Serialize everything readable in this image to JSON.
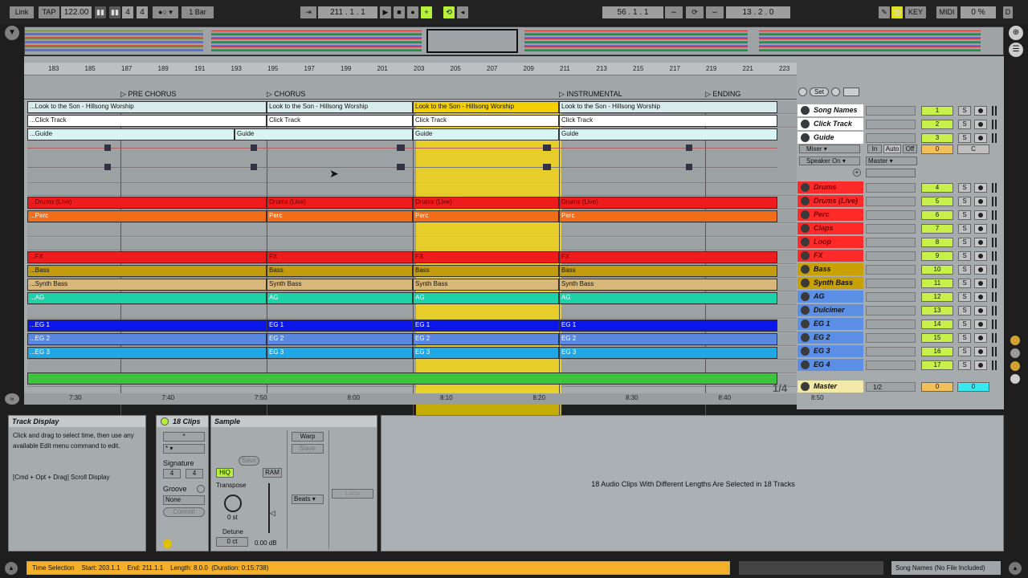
{
  "transport": {
    "link": "Link",
    "tap": "TAP",
    "tempo": "122.00",
    "sig_num": "4",
    "sig_den": "4",
    "quantize": "1 Bar",
    "position": "211 .   1 .   1",
    "loop_start": "56 .   1 .   1",
    "loop_length": "13 .   2 .   0",
    "key": "KEY",
    "midi": "MIDI",
    "cpu": "0 %",
    "disk": "D"
  },
  "ruler": {
    "bars": [
      "183",
      "185",
      "187",
      "189",
      "191",
      "193",
      "195",
      "197",
      "199",
      "201",
      "203",
      "205",
      "207",
      "209",
      "211",
      "213",
      "215",
      "217",
      "219",
      "221",
      "223"
    ]
  },
  "locators": [
    {
      "label": "PRE CHORUS"
    },
    {
      "label": "CHORUS"
    },
    {
      "label": "INSTRUMENTAL"
    },
    {
      "label": "ENDING"
    }
  ],
  "set_label": "Set",
  "times": [
    "7:30",
    "7:40",
    "7:50",
    "8:00",
    "8:10",
    "8:20",
    "8:30",
    "8:40",
    "8:50"
  ],
  "page_indicator": "1/4",
  "clips": {
    "song_names_a": "...Look to the Son - Hillsong Worship",
    "song_names": "Look to the Son - Hillsong Worship",
    "click_a": "...Click Track",
    "click": "Click Track",
    "guide_a": "...Guide",
    "guide": "Guide",
    "drums_a": "...Drums (Live)",
    "drums": "Drums (Live)",
    "perc_a": "...Perc",
    "perc": "Perc",
    "fx_a": "...FX",
    "fx": "FX",
    "bass_a": "...Bass",
    "bass": "Bass",
    "synth_a": "...Synth Bass",
    "synth": "Synth Bass",
    "ag_a": "...AG",
    "ag": "AG",
    "eg1_a": "...EG 1",
    "eg1": "EG 1",
    "eg2_a": "...EG 2",
    "eg2": "EG 2",
    "eg3_a": "...EG 3",
    "eg3": "EG 3",
    "s_trunc": "S"
  },
  "tracks": [
    {
      "name": "Song Names",
      "num": "1",
      "color": "#ffffff"
    },
    {
      "name": "Click Track",
      "num": "2",
      "color": "#ffffff"
    },
    {
      "name": "Guide",
      "num": "3",
      "color": "#ffffff"
    },
    {
      "name": "Drums",
      "num": "4",
      "color": "#ff2a2a"
    },
    {
      "name": "Drums (Live)",
      "num": "5",
      "color": "#ff2a2a"
    },
    {
      "name": "Perc",
      "num": "6",
      "color": "#ff2a2a"
    },
    {
      "name": "Claps",
      "num": "7",
      "color": "#ff2a2a"
    },
    {
      "name": "Loop",
      "num": "8",
      "color": "#ff2a2a"
    },
    {
      "name": "FX",
      "num": "9",
      "color": "#ff2a2a"
    },
    {
      "name": "Bass",
      "num": "10",
      "color": "#c8a000"
    },
    {
      "name": "Synth Bass",
      "num": "11",
      "color": "#c8a000"
    },
    {
      "name": "AG",
      "num": "12",
      "color": "#5b8fe6"
    },
    {
      "name": "Dulcimer",
      "num": "13",
      "color": "#5b8fe6"
    },
    {
      "name": "EG 1",
      "num": "14",
      "color": "#5b8fe6"
    },
    {
      "name": "EG 2",
      "num": "15",
      "color": "#5b8fe6"
    },
    {
      "name": "EG 3",
      "num": "16",
      "color": "#5b8fe6"
    },
    {
      "name": "EG 4",
      "num": "17",
      "color": "#5b8fe6"
    }
  ],
  "guide_options": {
    "mixer": "Mixer",
    "in": "In",
    "auto": "Auto",
    "off": "Off",
    "speaker": "Speaker On",
    "master_out": "Master",
    "send_val": "0",
    "pan": "C"
  },
  "master": {
    "name": "Master",
    "ratio": "1/2",
    "val": "0",
    "cue": "0"
  },
  "track_display": {
    "title": "Track Display",
    "body": "Click and drag to select time, then use any available Edit menu command to edit.",
    "hint": "[Cmd + Opt + Drag] Scroll Display"
  },
  "clip_panel": {
    "title": "18 Clips",
    "star": "*",
    "signature": "Signature",
    "sig_n": "4",
    "sig_d": "4",
    "groove": "Groove",
    "none": "None",
    "commit": "Commit"
  },
  "sample_panel": {
    "title": "Sample",
    "save": "Save",
    "hiq": "HiQ",
    "ram": "RAM",
    "transpose": "Transpose",
    "st": "0 st",
    "detune": "Detune",
    "ct": "0 ct",
    "db": "0.00 dB",
    "warp": "Warp",
    "slave": "Slave",
    "beats": "Beats",
    "loop": "Loop"
  },
  "info_text": "18 Audio Clips With Different Lengths Are Selected in 18 Tracks",
  "status": {
    "text": "Time Selection    Start: 203.1.1    End: 211.1.1    Length: 8.0.0  (Duration: 0:15:738)",
    "song": "Song Names (No File Included)"
  }
}
